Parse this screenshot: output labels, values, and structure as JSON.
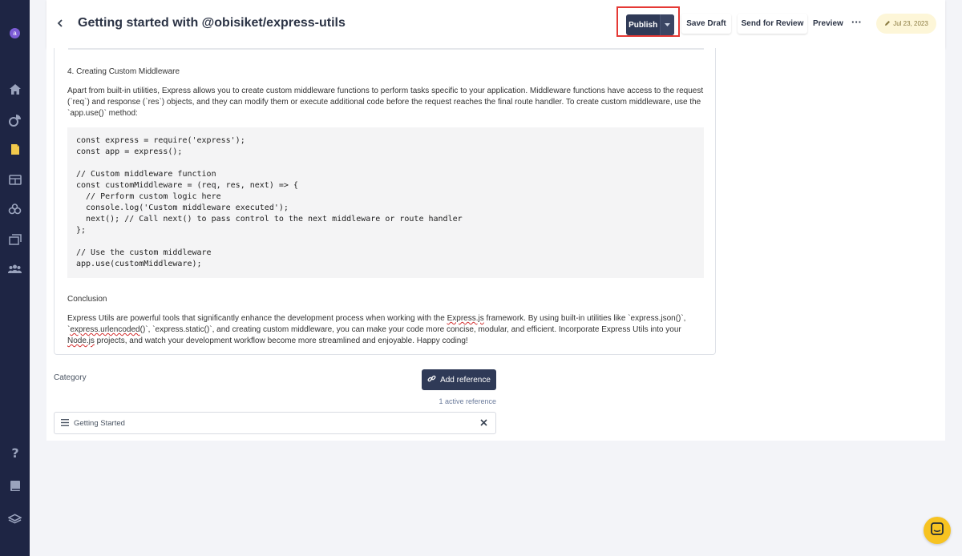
{
  "header": {
    "back_icon": "chevron-left-icon",
    "title": "Getting started with @obisiket/express-utils",
    "publish_label": "Publish",
    "save_draft_label": "Save Draft",
    "send_review_label": "Send for Review",
    "preview_label": "Preview",
    "more_label": "···",
    "date": "Jul 23, 2023"
  },
  "sidebar": {
    "avatar_letter": "a",
    "icons": [
      "home-icon",
      "analytics-icon",
      "document-icon",
      "table-icon",
      "people-icon",
      "gallery-icon",
      "team-icon",
      "help-icon",
      "book-icon",
      "layers-icon"
    ]
  },
  "editor": {
    "section_heading": "4. Creating Custom Middleware",
    "intro_paragraph": "Apart from built-in utilities, Express allows you to create custom middleware functions to perform tasks specific to your application. Middleware functions have access to the request (`req`) and response (`res`) objects, and they can modify them or execute additional code before the request reaches the final route handler. To create custom middleware, use the `app.use()` method:",
    "code_lines": [
      "const express = require('express');",
      "const app = express();",
      "",
      "// Custom middleware function",
      "const customMiddleware = (req, res, next) => {",
      "  // Perform custom logic here",
      "  console.log('Custom middleware executed');",
      "  next(); // Call next() to pass control to the next middleware or route handler",
      "};",
      "",
      "// Use the custom middleware",
      "app.use(customMiddleware);"
    ],
    "conclusion_heading": "Conclusion",
    "conclusion_parts": {
      "p1": "Express Utils are powerful tools that significantly enhance the development process when working with the ",
      "p2": "Express.js",
      "p3": " framework. By using built-in utilities like `express.json()`, `",
      "p4": "express.urlencoded",
      "p5": "()`, `express.static()`, and creating custom middleware, you can make your code more concise, modular, and efficient. Incorporate Express Utils into your ",
      "p6": "Node.js",
      "p7": " projects, and watch your development workflow become more streamlined and enjoyable. Happy coding!"
    }
  },
  "category": {
    "label": "Category",
    "add_reference_label": "Add reference",
    "active_reference_text": "1 active reference",
    "item_name": "Getting Started"
  },
  "colors": {
    "sidebar_bg": "#1e2544",
    "primary_button": "#2f3a57",
    "highlight_border": "#e53935",
    "chat_button": "#f7c321"
  }
}
